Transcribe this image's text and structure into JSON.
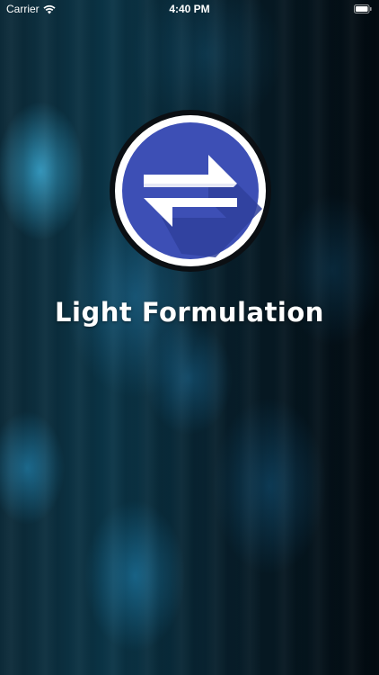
{
  "status_bar": {
    "carrier": "Carrier",
    "time": "4:40 PM",
    "wifi_icon": "wifi-icon",
    "battery_icon": "battery-icon"
  },
  "logo": {
    "icon": "swap-arrows-icon",
    "colors": {
      "outer_ring": "#0b0f13",
      "white_ring": "#ffffff",
      "circle_blue": "#3d4fb5",
      "circle_blue_dark": "#2f3f9c",
      "arrow": "#ffffff"
    }
  },
  "app_title": "Light Formulation"
}
